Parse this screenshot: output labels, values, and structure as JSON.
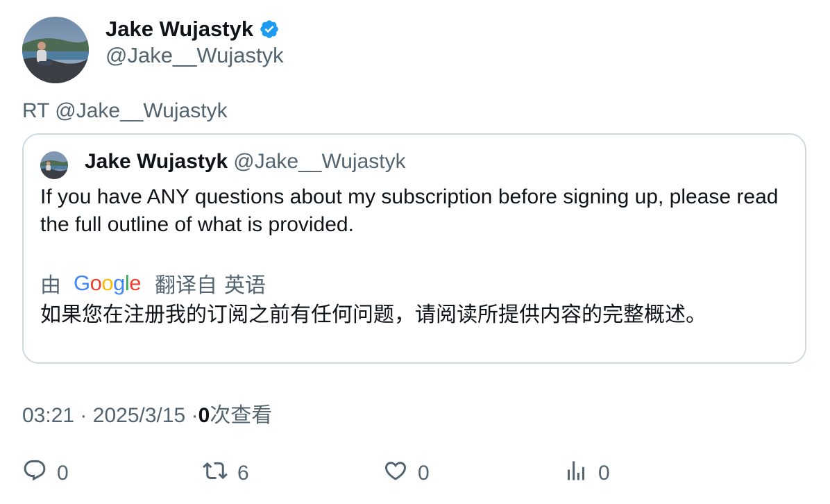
{
  "tweet": {
    "author_name": "Jake Wujastyk",
    "author_handle": "@Jake__Wujastyk",
    "rt_text": "RT @Jake__Wujastyk",
    "quote": {
      "author_name": "Jake Wujastyk",
      "author_handle": "@Jake__Wujastyk",
      "text": "If you have ANY questions about my subscription before signing up, please read the full outline of what is provided.",
      "translation_by": "由",
      "translation_provider": "Google",
      "translation_from": "翻译自",
      "translation_language": "英语",
      "translated_text": "如果您在注册我的订阅之前有任何问题，请阅读所提供内容的完整概述。"
    },
    "meta": {
      "time": "03:21",
      "separator": "·",
      "date": "2025/3/15",
      "views_count": "0",
      "views_label": "次查看"
    },
    "actions": {
      "reply_count": "0",
      "retweet_count": "6",
      "like_count": "0",
      "views_count": "0"
    },
    "colors": {
      "verified": "#1d9bf0",
      "muted": "#536471",
      "border": "#cfd9de"
    }
  }
}
